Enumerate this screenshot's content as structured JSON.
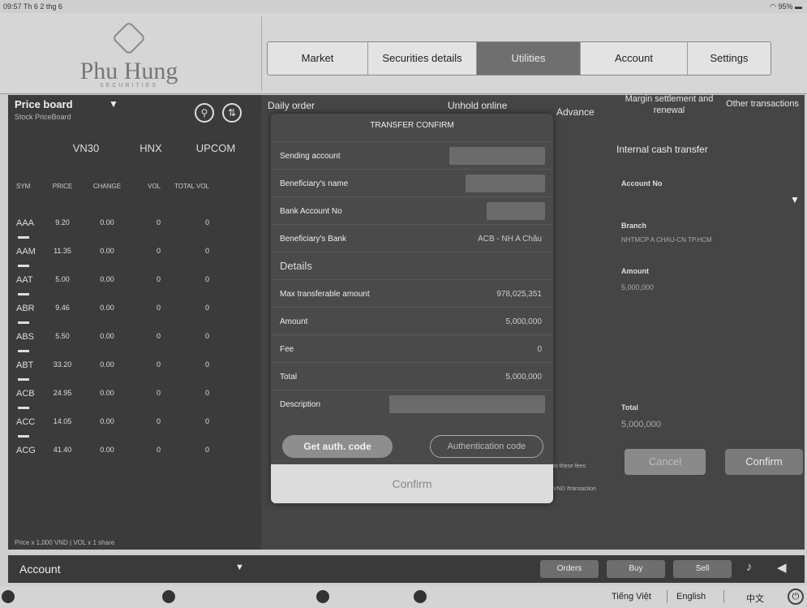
{
  "status": {
    "time": "09:57  Th 6 2 thg 6",
    "battery": "95%"
  },
  "brand": {
    "name": "Phu Hung",
    "sub": "SECURITIES"
  },
  "nav": {
    "tabs": [
      "Market",
      "Securities details",
      "Utilities",
      "Account",
      "Settings"
    ],
    "active": "Utilities"
  },
  "price_board": {
    "title": "Price board",
    "subtitle": "Stock PriceBoard",
    "index_tabs": [
      "VN30",
      "HNX",
      "UPCOM"
    ],
    "columns": [
      "SYM",
      "PRICE",
      "CHANGE",
      "VOL",
      "TOTAL VOL"
    ],
    "rows": [
      {
        "sym": "AAA",
        "price": "9.20",
        "change": "0.00",
        "vol": "0",
        "tvol": "0"
      },
      {
        "sym": "AAM",
        "price": "11.35",
        "change": "0.00",
        "vol": "0",
        "tvol": "0"
      },
      {
        "sym": "AAT",
        "price": "5.00",
        "change": "0.00",
        "vol": "0",
        "tvol": "0"
      },
      {
        "sym": "ABR",
        "price": "9.46",
        "change": "0.00",
        "vol": "0",
        "tvol": "0"
      },
      {
        "sym": "ABS",
        "price": "5.50",
        "change": "0.00",
        "vol": "0",
        "tvol": "0"
      },
      {
        "sym": "ABT",
        "price": "33.20",
        "change": "0.00",
        "vol": "0",
        "tvol": "0"
      },
      {
        "sym": "ACB",
        "price": "24.95",
        "change": "0.00",
        "vol": "0",
        "tvol": "0"
      },
      {
        "sym": "ACC",
        "price": "14.05",
        "change": "0.00",
        "vol": "0",
        "tvol": "0"
      },
      {
        "sym": "ACG",
        "price": "41.40",
        "change": "0.00",
        "vol": "0",
        "tvol": "0"
      }
    ],
    "footer": "Price x 1,000 VND | VOL x 1 share"
  },
  "subtabs": {
    "daily_order": "Daily order",
    "unhold_online": "Unhold online",
    "advance": "Advance",
    "margin": "Margin settlement and renewal",
    "other": "Other transactions"
  },
  "internal_transfer": {
    "title": "Internal cash transfer",
    "account_no_label": "Account No",
    "branch_label": "Branch",
    "branch_value": "NHTMCP A CHAU-CN TP.HCM",
    "amount_label": "Amount",
    "amount_value": "5,000,000",
    "total_label": "Total",
    "total_value": "5,000,000",
    "cancel": "Cancel",
    "confirm": "Confirm",
    "note1": "to these fees",
    "note2": "VND /transaction"
  },
  "modal": {
    "title": "TRANSFER CONFIRM",
    "sending_account_label": "Sending account",
    "beneficiary_name_label": "Beneficiary's name",
    "bank_account_label": "Bank Account No",
    "beneficiary_bank_label": "Beneficiary's Bank",
    "beneficiary_bank_value": "ACB - NH A Châu",
    "details_label": "Details",
    "max_label": "Max transferable amount",
    "max_value": "978,025,351",
    "amount_label": "Amount",
    "amount_value": "5,000,000",
    "fee_label": "Fee",
    "fee_value": "0",
    "total_label": "Total",
    "total_value": "5,000,000",
    "description_label": "Description",
    "get_auth": "Get auth. code",
    "auth_placeholder": "Authentication code",
    "confirm": "Confirm"
  },
  "bottom": {
    "account": "Account",
    "orders": "Orders",
    "buy": "Buy",
    "sell": "Sell"
  },
  "footer": {
    "lang_vi": "Tiếng Việt",
    "lang_en": "English",
    "lang_zh": "中文"
  }
}
